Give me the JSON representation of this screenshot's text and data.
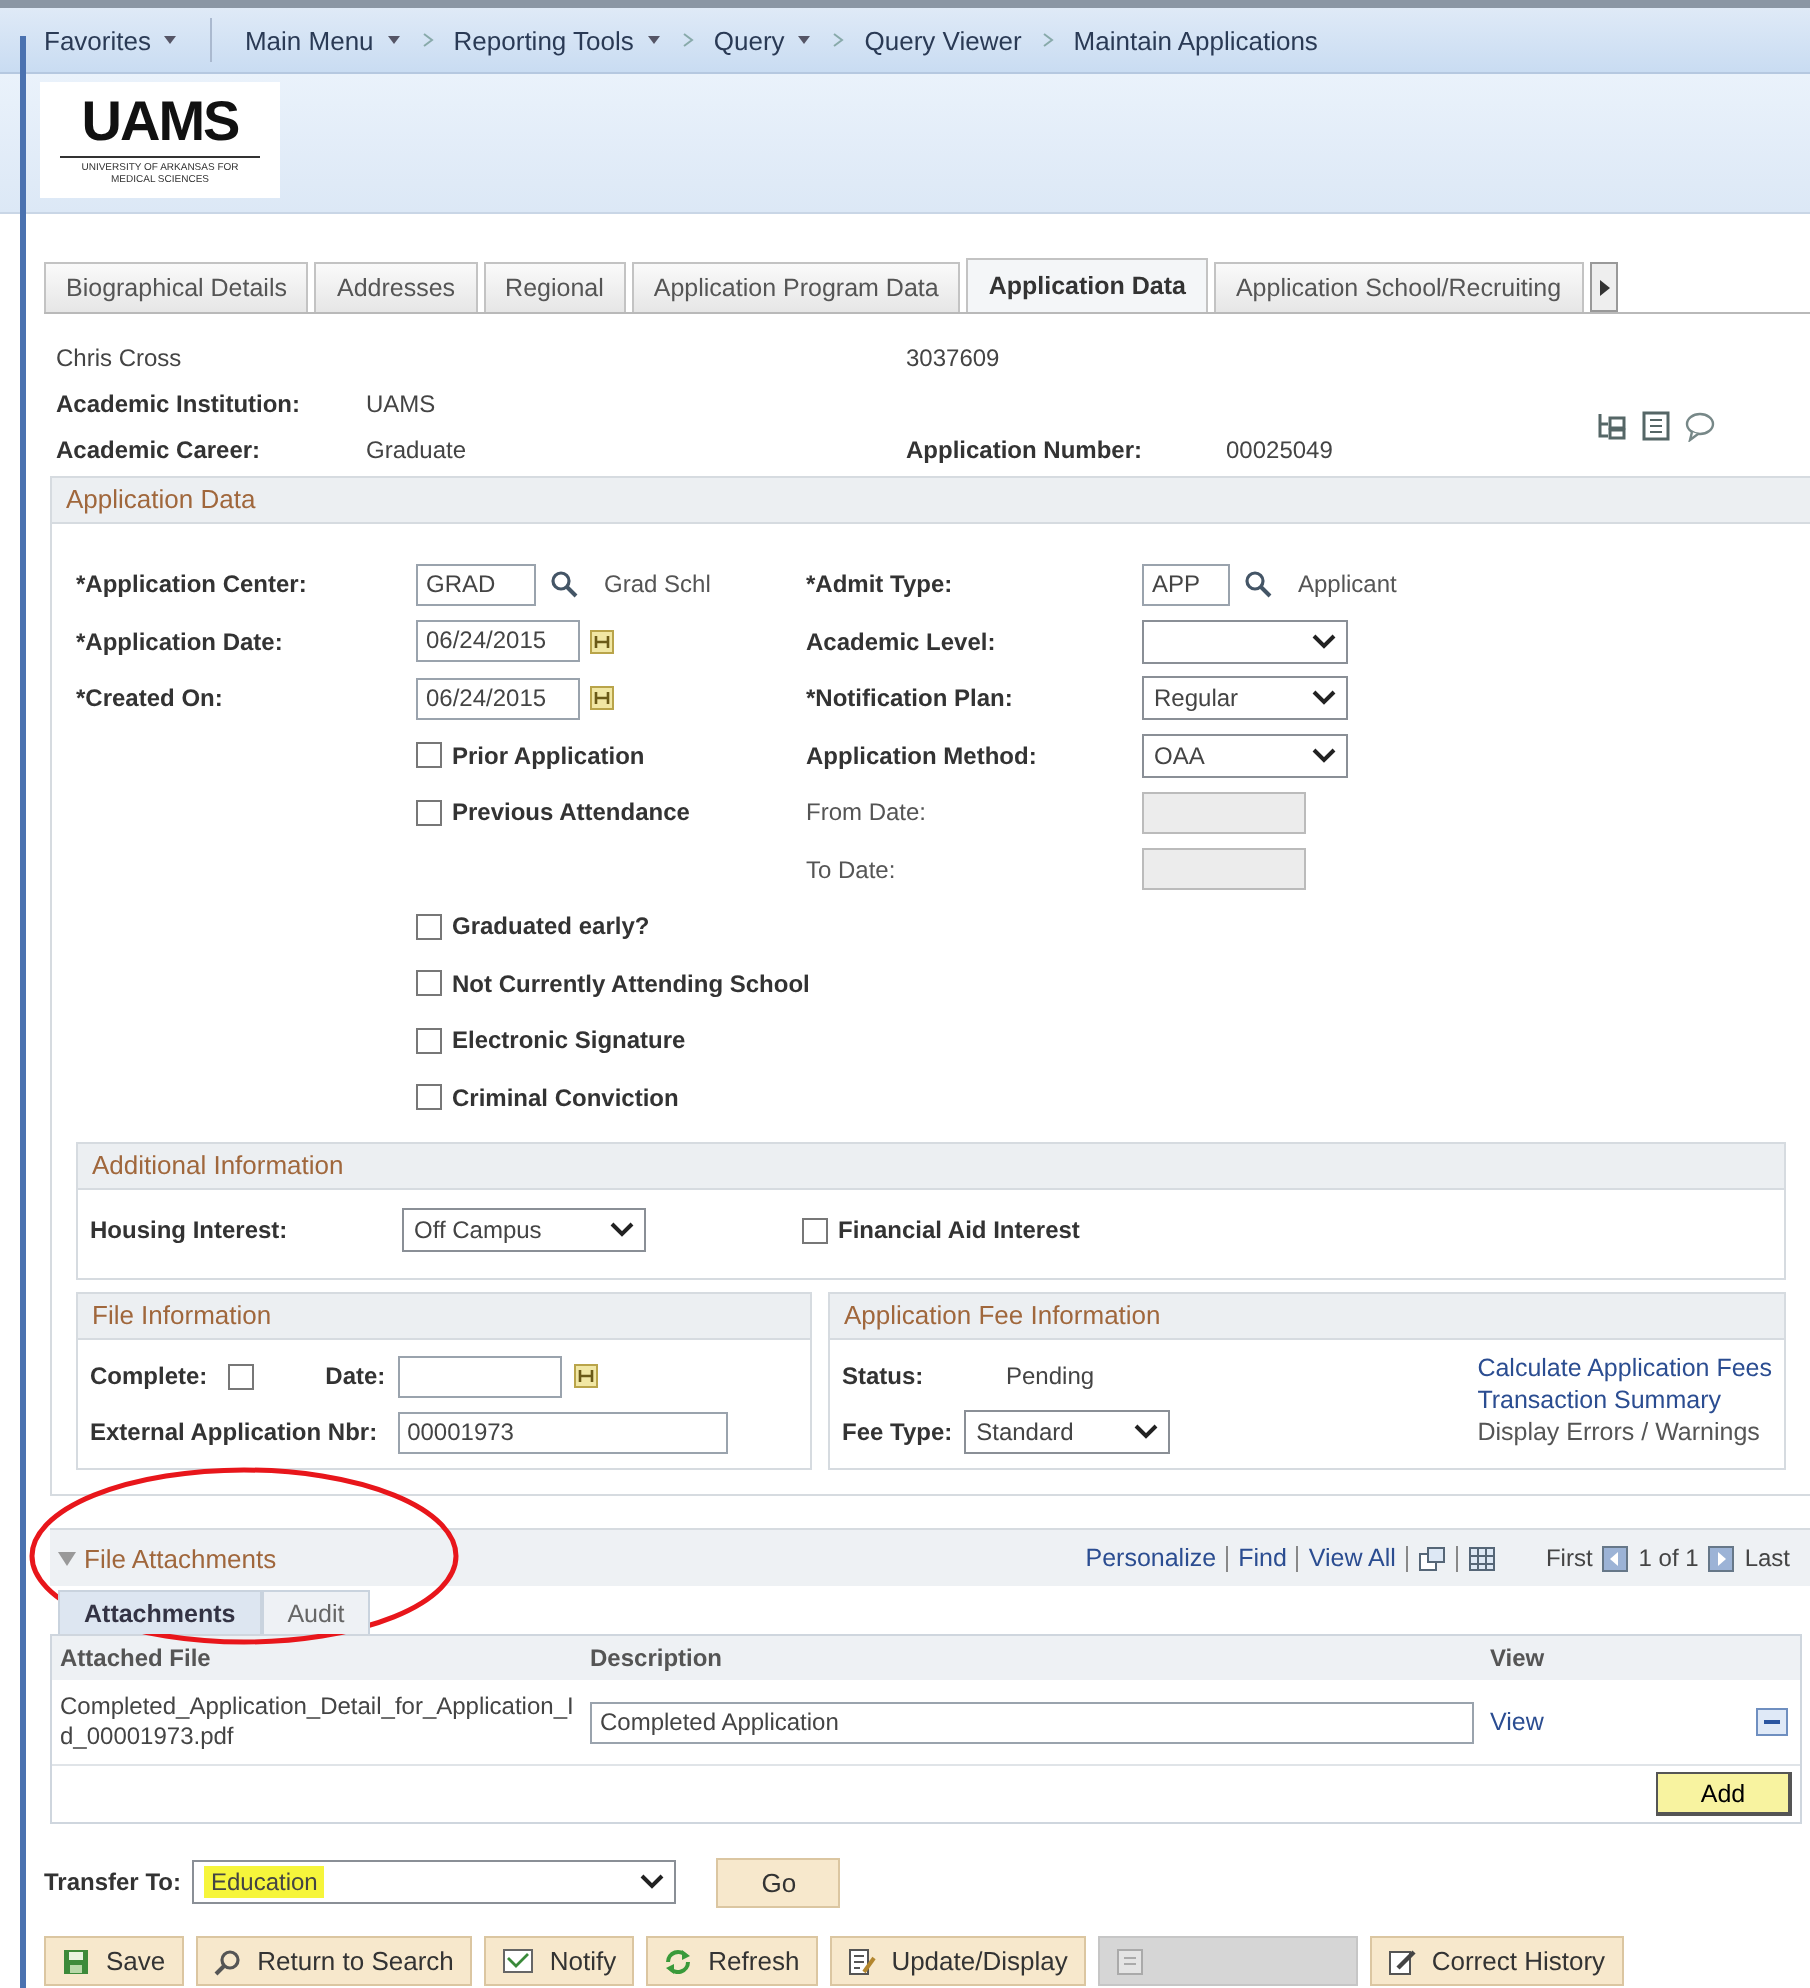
{
  "breadcrumb": [
    {
      "label": "Favorites",
      "menu": true
    },
    {
      "label": "Main Menu",
      "menu": true
    },
    {
      "label": "Reporting Tools",
      "menu": true
    },
    {
      "label": "Query",
      "menu": true
    },
    {
      "label": "Query Viewer",
      "menu": false
    },
    {
      "label": "Maintain Applications",
      "menu": false
    }
  ],
  "logo": {
    "wordmark": "UAMS",
    "tagline": "UNIVERSITY OF ARKANSAS FOR MEDICAL SCIENCES"
  },
  "tabs": [
    {
      "label": "Biographical Details",
      "selected": false
    },
    {
      "label": "Addresses",
      "selected": false
    },
    {
      "label": "Regional",
      "selected": false
    },
    {
      "label": "Application Program Data",
      "selected": false
    },
    {
      "label": "Application Data",
      "selected": true
    },
    {
      "label": "Application School/Recruiting",
      "selected": false
    }
  ],
  "header": {
    "name": "Chris Cross",
    "id": "3037609",
    "institution": {
      "label": "Academic Institution:",
      "value": "UAMS"
    },
    "career": {
      "label": "Academic Career:",
      "value": "Graduate"
    },
    "app_number": {
      "label": "Application Number:",
      "value": "00025049"
    }
  },
  "application_data": {
    "title": "Application Data",
    "app_center": {
      "label": "*Application Center:",
      "value": "GRAD",
      "description": "Grad Schl"
    },
    "admit_type": {
      "label": "*Admit Type:",
      "value": "APP",
      "description": "Applicant"
    },
    "app_date": {
      "label": "*Application Date:",
      "value": "06/24/2015"
    },
    "academic_level": {
      "label": "Academic Level:"
    },
    "created_on": {
      "label": "*Created On:",
      "value": "06/24/2015"
    },
    "notification_plan": {
      "label": "*Notification Plan:",
      "value": "Regular"
    },
    "application_method": {
      "label": "Application Method:",
      "value": "OAA"
    },
    "from_date": {
      "label": "From Date:",
      "disabled": true
    },
    "to_date": {
      "label": "To Date:",
      "disabled": true
    },
    "checkboxes": [
      {
        "label": "Prior Application",
        "checked": false
      },
      {
        "label": "Previous Attendance",
        "checked": false
      },
      {
        "label": "Graduated early?",
        "checked": false
      },
      {
        "label": "Not Currently Attending School",
        "checked": false
      },
      {
        "label": "Electronic Signature",
        "checked": false
      },
      {
        "label": "Criminal Conviction",
        "checked": false
      }
    ]
  },
  "additional_information": {
    "title": "Additional Information",
    "housing": {
      "label": "Housing Interest:",
      "value": "Off Campus"
    },
    "financial_aid": {
      "label": "Financial Aid Interest",
      "checked": false
    }
  },
  "file_information": {
    "title": "File Information",
    "complete": {
      "label": "Complete:",
      "checked": false
    },
    "date": {
      "label": "Date:"
    },
    "external_nbr": {
      "label": "External Application Nbr:",
      "value": "00001973"
    }
  },
  "fee_information": {
    "title": "Application Fee Information",
    "status": {
      "label": "Status:",
      "value": "Pending"
    },
    "fee_type": {
      "label": "Fee Type:",
      "value": "Standard"
    },
    "links": [
      "Calculate Application Fees",
      "Transaction Summary",
      "Display Errors / Warnings"
    ]
  },
  "file_attachments": {
    "title": "File Attachments",
    "expanded": true,
    "links": [
      "Personalize",
      "Find",
      "View All"
    ],
    "first": "First",
    "count": "1 of 1",
    "last": "Last",
    "tabs": [
      {
        "label": "Attachments",
        "selected": true
      },
      {
        "label": "Audit",
        "selected": false
      }
    ],
    "columns": [
      "Attached File",
      "Description",
      "View"
    ],
    "rows": [
      {
        "file": "Completed_Application_Detail_for_Application_Id_00001973.pdf",
        "description": "Completed Application",
        "view": "View"
      }
    ],
    "add": "Add"
  },
  "transfer": {
    "label": "Transfer To:",
    "value": "Education",
    "highlighted": true,
    "go": "Go"
  },
  "buttons": [
    {
      "kind": "save",
      "label": "Save",
      "disabled": false
    },
    {
      "kind": "search",
      "label": "Return to Search",
      "disabled": false
    },
    {
      "kind": "notify",
      "label": "Notify",
      "disabled": false
    },
    {
      "kind": "refresh",
      "label": "Refresh",
      "disabled": false
    },
    {
      "kind": "update",
      "label": "Update/Display",
      "disabled": false
    },
    {
      "kind": "history",
      "disabled": true
    },
    {
      "kind": "correct",
      "label": "Correct History",
      "disabled": false
    }
  ],
  "annotation": {
    "kind": "ellipse",
    "color": "#e8161b"
  }
}
